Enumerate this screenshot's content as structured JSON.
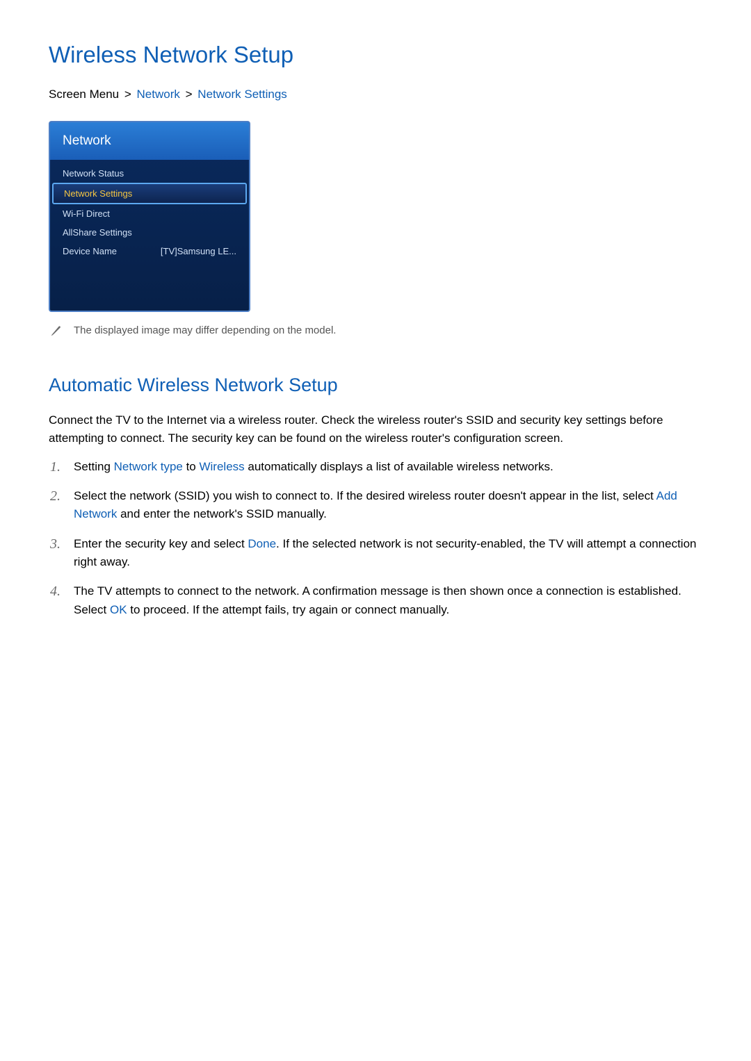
{
  "title": "Wireless Network Setup",
  "breadcrumb": {
    "prefix": "Screen Menu",
    "part1": "Network",
    "part2": "Network Settings"
  },
  "menu": {
    "header": "Network",
    "items": [
      {
        "label": "Network Status",
        "value": "",
        "selected": false
      },
      {
        "label": "Network Settings",
        "value": "",
        "selected": true
      },
      {
        "label": "Wi-Fi Direct",
        "value": "",
        "selected": false
      },
      {
        "label": "AllShare Settings",
        "value": "",
        "selected": false
      },
      {
        "label": "Device Name",
        "value": "[TV]Samsung LE...",
        "selected": false
      }
    ]
  },
  "note": "The displayed image may differ depending on the model.",
  "section": {
    "heading": "Automatic Wireless Network Setup",
    "intro": "Connect the TV to the Internet via a wireless router. Check the wireless router's SSID and security key settings before attempting to connect. The security key can be found on the wireless router's configuration screen.",
    "steps": [
      {
        "pre1": "Setting ",
        "hl1": "Network type",
        "mid1": " to ",
        "hl2": "Wireless",
        "post1": " automatically displays a list of available wireless networks."
      },
      {
        "pre1": "Select the network (SSID) you wish to connect to. If the desired wireless router doesn't appear in the list, select ",
        "hl1": "Add Network",
        "post1": " and enter the network's SSID manually."
      },
      {
        "pre1": "Enter the security key and select ",
        "hl1": "Done",
        "post1": ". If the selected network is not security-enabled, the TV will attempt a connection right away."
      },
      {
        "pre1": "The TV attempts to connect to the network. A confirmation message is then shown once a connection is established. Select ",
        "hl1": "OK",
        "post1": " to proceed. If the attempt fails, try again or connect manually."
      }
    ]
  }
}
